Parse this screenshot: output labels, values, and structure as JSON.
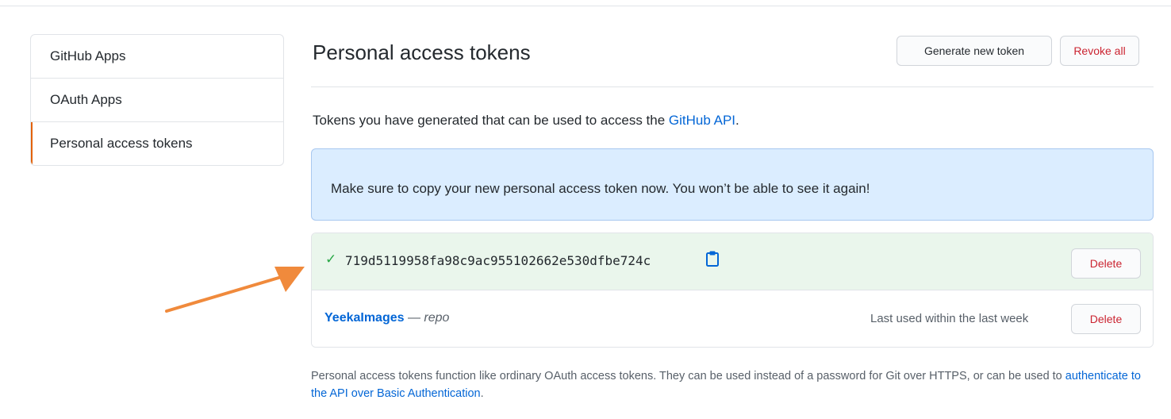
{
  "sidebar": {
    "items": [
      {
        "label": "GitHub Apps",
        "active": false
      },
      {
        "label": "OAuth Apps",
        "active": false
      },
      {
        "label": "Personal access tokens",
        "active": true
      }
    ]
  },
  "header": {
    "title": "Personal access tokens",
    "generate_label": "Generate new token",
    "revoke_label": "Revoke all"
  },
  "intro": {
    "text": "Tokens you have generated that can be used to access the ",
    "link_text": "GitHub API",
    "suffix": "."
  },
  "flash": {
    "message": "Make sure to copy your new personal access token now. You won’t be able to see it again!"
  },
  "new_token": {
    "check_icon": "check-icon",
    "value": "719d5119958fa98c9ac955102662e530dfbe724c",
    "copy_icon": "clipboard-icon",
    "delete_label": "Delete"
  },
  "existing_token": {
    "name": "YeekaImages",
    "dash": " — ",
    "scope": "repo",
    "last_used": "Last used within the last week",
    "delete_label": "Delete"
  },
  "footer": {
    "text_before": "Personal access tokens function like ordinary OAuth access tokens. They can be used instead of a password for Git over HTTPS, or can be used to ",
    "link_text": "authenticate to the API over Basic Authentication",
    "text_after": "."
  },
  "colors": {
    "accent": "#e36209",
    "link": "#0366d6",
    "danger": "#cb2431",
    "success": "#28a745",
    "flash_bg": "#dbedff",
    "token_bg": "#eaf6ec",
    "annotation_arrow": "#f08a3c"
  }
}
